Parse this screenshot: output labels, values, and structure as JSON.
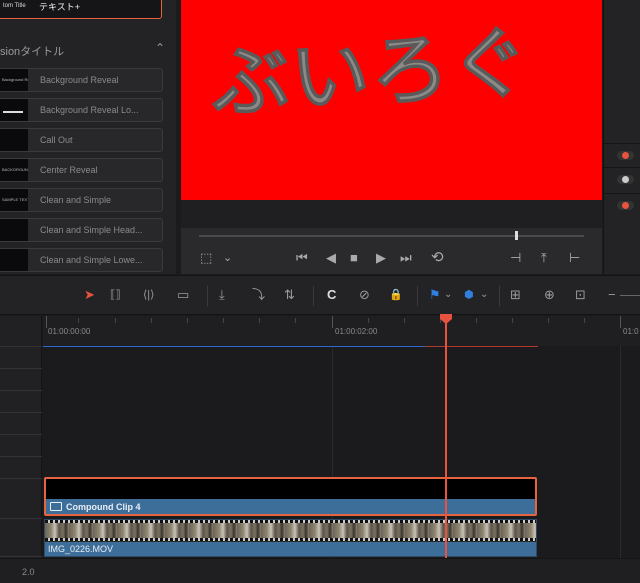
{
  "effects_panel": {
    "top_item": {
      "thumb_text": "tom Title",
      "name": "テキスト+"
    },
    "section_title": "sionタイトル",
    "section_chevron": "⌃",
    "items": [
      {
        "thumb_text": "Background Reveal",
        "name": "Background Reveal"
      },
      {
        "thumb_text": "",
        "name": "Background Reveal Lo..."
      },
      {
        "thumb_text": "",
        "name": "Call Out"
      },
      {
        "thumb_text": "BACKGROUND",
        "name": "Center Reveal"
      },
      {
        "thumb_text": "SAMPLE TEXT",
        "name": "Clean and Simple"
      },
      {
        "thumb_text": "",
        "name": "Clean and Simple Head..."
      },
      {
        "thumb_text": "",
        "name": "Clean and Simple Lowe..."
      }
    ]
  },
  "viewer": {
    "frame_text": "ぶいろぐ",
    "background_color": "#fe0000"
  },
  "transport": {
    "go_first": "⏮",
    "play_reverse": "◀",
    "stop": "■",
    "play": "▶",
    "go_last": "⏭",
    "loop": "⟲",
    "crop_icon": "⬚",
    "crop_chevron": "⌄",
    "prev_frame": "⊣",
    "match_frame": "⤒",
    "next_edit": "⊢"
  },
  "toolbar": {
    "select_tool": "➤",
    "trim_tool": "⟦⟧",
    "dynamic_trim": "⟨|⟩",
    "blade_tool": "▭",
    "insert": "⤓",
    "overwrite": "⤵",
    "replace": "⇅",
    "snapping": "C",
    "link": "⊘",
    "lock": "🔒",
    "flag": "⚑",
    "flag_chevron": "⌄",
    "marker": "⬢",
    "marker_chevron": "⌄",
    "zoom_full": "⊞",
    "zoom_detail": "⊕",
    "zoom_custom": "⊡",
    "zoom_out": "−"
  },
  "timeline": {
    "timecodes": [
      "01:00:00:00",
      "01:00:02:00",
      "01:0"
    ],
    "compound_clip_label": "Compound Clip 4",
    "video_clip_label": "IMG_0226.MOV",
    "bottom_value": "2.0"
  },
  "colors": {
    "accent": "#e8633f",
    "clip_blue": "#3d6e99",
    "playhead": "#e8533f",
    "toggle_on": "#e8533f",
    "toggle_off": "#cccccc"
  }
}
